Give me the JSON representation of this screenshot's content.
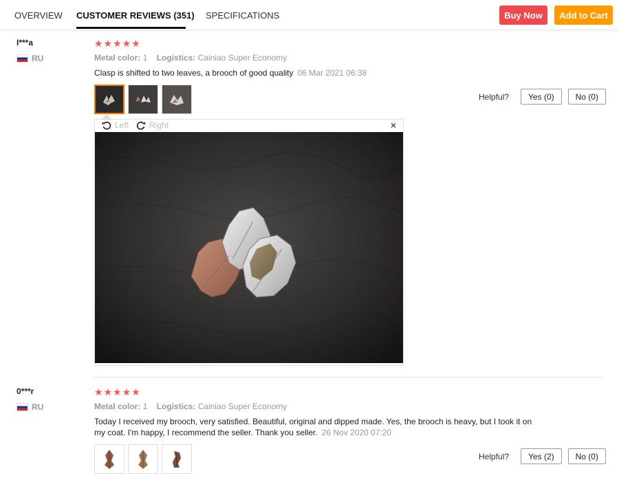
{
  "tabs": {
    "overview": "OVERVIEW",
    "reviews": "CUSTOMER REVIEWS (351)",
    "specs": "SPECIFICATIONS"
  },
  "actions": {
    "buy_now": "Buy Now",
    "add_to_cart": "Add to Cart"
  },
  "colors": {
    "buy_now": "#f0494d",
    "add_to_cart": "#ff9a00",
    "stars": "#ff5555",
    "selected_thumb_border": "#ff7400"
  },
  "reviews": [
    {
      "user": "I***a",
      "country": "RU",
      "stars": "★★★★★",
      "rating": 5,
      "color_label": "Metal color:",
      "color_value": "1",
      "logistics_label": "Logistics:",
      "logistics_value": "Cainiao Super Economy",
      "text": "Clasp is shifted to two leaves, a brooch of good quality",
      "date": "06 Mar 2021 06:38",
      "helpful_label": "Helpful?",
      "yes": "Yes (0)",
      "no": "No (0)",
      "viewer": {
        "rotate_left": "Left",
        "rotate_right": "Right",
        "close": "×"
      }
    },
    {
      "user": "0***r",
      "country": "RU",
      "stars": "★★★★★",
      "rating": 5,
      "color_label": "Metal color:",
      "color_value": "1",
      "logistics_label": "Logistics:",
      "logistics_value": "Cainiao Super Economy",
      "text": "Today I received my brooch, very satisfied. Beautiful, original and dipped made. Yes, the brooch is heavy, but I took it on my coat. I'm happy, I recommend the seller. Thank you seller.",
      "date": "26 Nov 2020 07:20",
      "helpful_label": "Helpful?",
      "yes": "Yes (2)",
      "no": "No (0)"
    }
  ]
}
